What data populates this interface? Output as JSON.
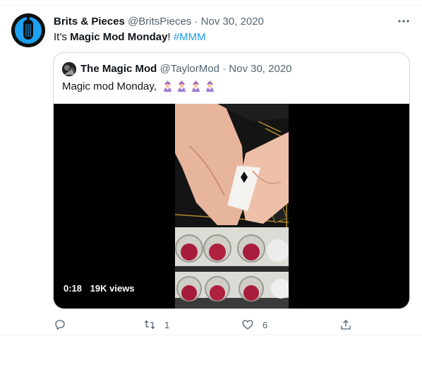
{
  "tweet": {
    "display_name": "Brits & Pieces",
    "handle": "@BritsPieces",
    "date": "Nov 30, 2020",
    "text_prefix": "It’s ",
    "text_bold": "Magic Mod Monday",
    "text_bang": "!",
    "hashtag": "#MMM"
  },
  "quote": {
    "display_name": "The Magic Mod",
    "handle": "@TaylorMod",
    "date": "Nov 30, 2020",
    "text": "Magic mod Monday,",
    "emoji": [
      "magician-emoji",
      "magician-emoji",
      "magician-emoji",
      "magician-emoji"
    ],
    "video": {
      "duration": "0:18",
      "views": "19K views"
    }
  },
  "actions": {
    "replies": "",
    "retweets": "1",
    "likes": "6"
  },
  "colors": {
    "accent": "#1d9bf0",
    "muted": "#536471",
    "border": "#cfd9de"
  },
  "icons": [
    "guitar-logo-icon",
    "more-icon",
    "reply-icon",
    "retweet-icon",
    "like-icon",
    "share-icon"
  ]
}
